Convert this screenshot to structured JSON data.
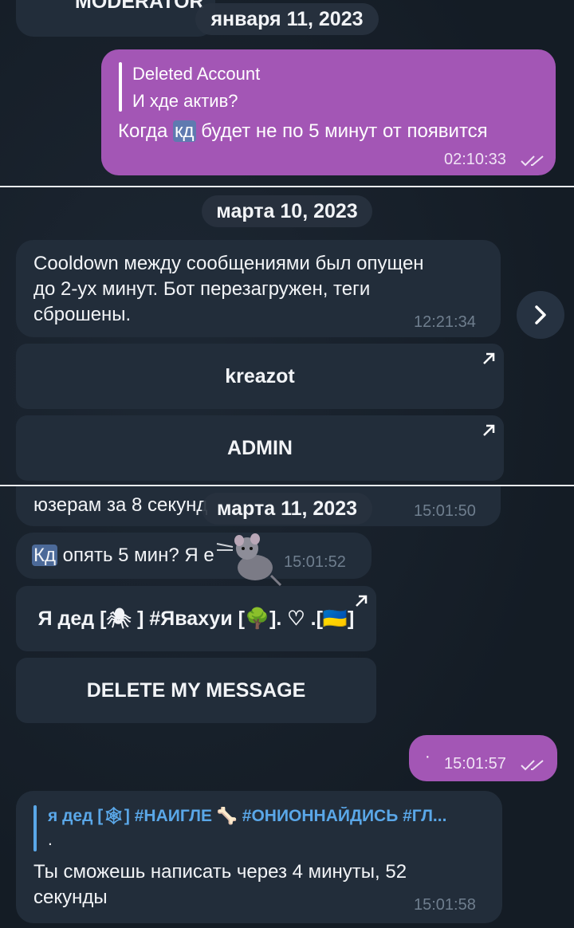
{
  "panel1": {
    "moderator_label": "MODERATOR",
    "date": "января 11, 2023",
    "out_msg": {
      "reply_author": "Deleted Account",
      "reply_text": "И хде актив?",
      "text_before": "Когда ",
      "text_highlight": "кд",
      "text_after": " будет не по 5 минут от появится",
      "time": "02:10:33"
    }
  },
  "panel2": {
    "date": "марта 10, 2023",
    "msg": {
      "lines": [
        "Cooldown между сообщениями был опущен",
        "до 2-ух минут. Бот перезагружен, теги",
        "сброшены."
      ],
      "time": "12:21:34"
    },
    "buttons": [
      "kreazot",
      "ADMIN"
    ]
  },
  "panel3": {
    "date": "марта 11, 2023",
    "cut_msg": {
      "text": "юзерам за 8 секунд",
      "time": "15:01:50"
    },
    "msg2": {
      "highlight": "Кд",
      "text": " опять 5 мин? Я е",
      "time": "15:01:52"
    },
    "button_tag": "Я дед [🕷 ] #Явахуи [🌳]. ♡ .[🇺🇦]",
    "button_delete": "DELETE MY MESSAGE",
    "out_msg": {
      "dot": "·",
      "time": "15:01:57"
    },
    "reply_msg": {
      "reply_author": "я дед [🕸] #НАИГЛЕ 🦴 #ОНИОННАЙДИСЬ #ГЛ...",
      "reply_text": ".",
      "lines": [
        "Ты сможешь написать через 4 минуты, 52",
        "секунды"
      ],
      "time": "15:01:58"
    }
  },
  "colors": {
    "outgoing": "#a356b5",
    "incoming": "#222d3a",
    "background": "#17202b",
    "accent": "#5aa7e8"
  },
  "icons": {
    "forward": "chevron-right-icon",
    "read": "double-check-icon",
    "open": "arrow-up-right-icon"
  }
}
